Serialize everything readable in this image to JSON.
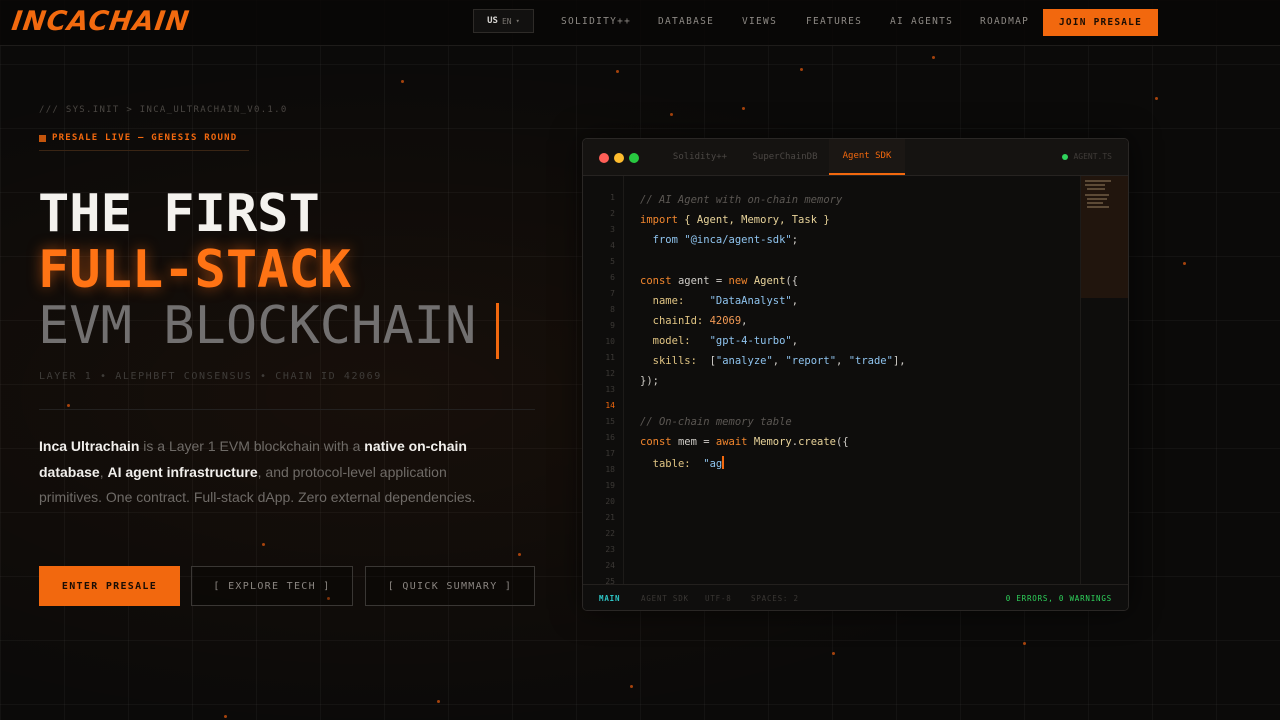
{
  "nav": {
    "logo": "INCACHAIN",
    "lang": {
      "code": "US",
      "sub": "EN"
    },
    "links": [
      "SOLIDITY++",
      "DATABASE",
      "VIEWS",
      "FEATURES",
      "AI AGENTS",
      "ROADMAP"
    ],
    "cta": "JOIN PRESALE"
  },
  "hero": {
    "sysline": "/// SYS.INIT > INCA_ULTRACHAIN_V0.1.0",
    "badge": "PRESALE LIVE — GENESIS ROUND",
    "title_line1": "THE FIRST",
    "title_line2": "FULL-STACK",
    "title_line3": "EVM BLOCKCHAIN",
    "subline": "LAYER 1 • ALEPHBFT CONSENSUS • CHAIN ID 42069",
    "desc": {
      "b1": "Inca Ultrachain",
      "t1": " is a Layer 1 EVM blockchain with a ",
      "b2": "native on-chain database",
      "t2": ", ",
      "b3": "AI agent infrastructure",
      "t3": ", and protocol-level application primitives. One contract. Full-stack dApp. Zero external dependencies."
    },
    "buttons": {
      "primary": "ENTER PRESALE",
      "tech": "[ EXPLORE TECH ]",
      "summary": "[ QUICK SUMMARY ]"
    }
  },
  "editor": {
    "tabs": [
      "Solidity++",
      "SuperChainDB",
      "Agent SDK"
    ],
    "active_tab": "Agent SDK",
    "file": "AGENT.TS",
    "line_numbers": [
      "1",
      "2",
      "3",
      "4",
      "5",
      "6",
      "7",
      "8",
      "9",
      "10",
      "11",
      "12",
      "13",
      "14",
      "15",
      "16",
      "17",
      "18",
      "19",
      "20",
      "21",
      "22",
      "23",
      "24",
      "25"
    ],
    "current_line": "14",
    "code": {
      "l1": "// AI Agent with on-chain memory",
      "import_kw": "import",
      "import_names": "{ Agent, Memory, Task }",
      "from_kw": "from",
      "from_path": "\"@inca/agent-sdk\"",
      "const_kw": "const",
      "agent_var": "agent",
      "new_kw": "new",
      "agent_cls": "Agent",
      "name_key": "name:",
      "name_val": "\"DataAnalyst\"",
      "chain_key": "chainId:",
      "chain_val": "42069",
      "model_key": "model:",
      "model_val": "\"gpt-4-turbo\"",
      "skills_key": "skills:",
      "skill1": "\"analyze\"",
      "skill2": "\"report\"",
      "skill3": "\"trade\"",
      "close": "});",
      "l2_comment": "// On-chain memory table",
      "mem_var": "mem",
      "await_kw": "await",
      "mem_cls": "Memory",
      "create_fn": "create",
      "table_key": "table:",
      "table_val": "\"ag"
    },
    "status": {
      "branch": "MAIN",
      "sdk": "AGENT SDK",
      "encoding": "UTF-8",
      "spaces": "SPACES: 2",
      "problems": "0 ERRORS, 0 WARNINGS"
    }
  },
  "colors": {
    "accent": "#f2680e",
    "background": "#0b0a09",
    "success": "#2fd35c"
  }
}
